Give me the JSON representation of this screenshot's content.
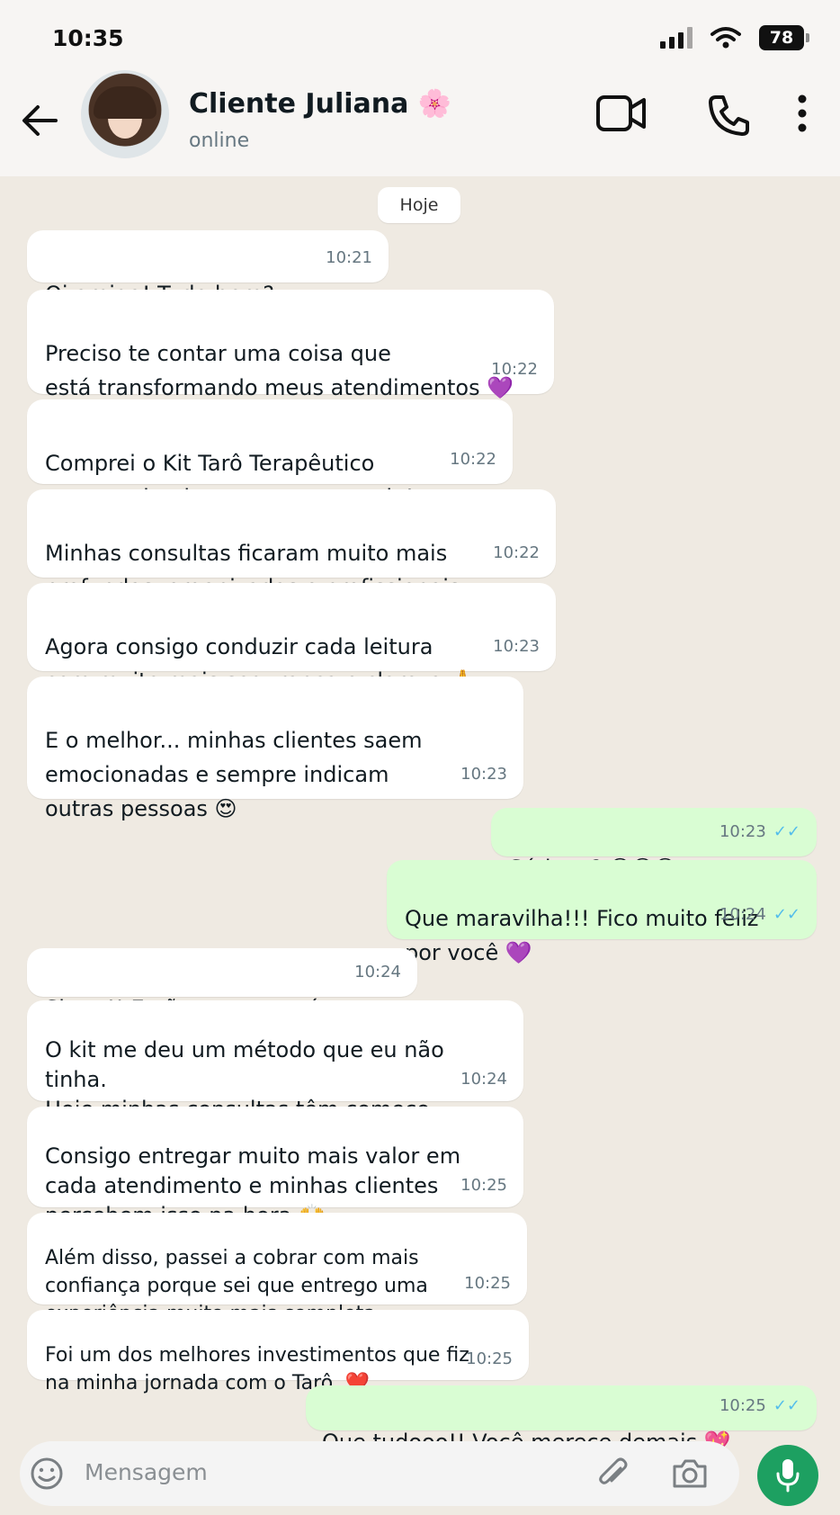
{
  "status_bar": {
    "time": "10:35",
    "battery": "78"
  },
  "header": {
    "name": "Cliente Juliana 🌸",
    "status": "online"
  },
  "date_chip": "Hoje",
  "messages": [
    {
      "text": "Oi amiga! Tudo bem?",
      "time": "10:21",
      "dir": "in"
    },
    {
      "text": "Preciso te contar uma coisa que\nestá transformando meus atendimentos 💜",
      "time": "10:22",
      "dir": "in"
    },
    {
      "text": "Comprei o Kit Tarô Terapêutico\ne estou simplesmente encantada!",
      "time": "10:22",
      "dir": "in"
    },
    {
      "text": "Minhas consultas ficaram muito mais\nprofundas, organizadas e profissionais.",
      "time": "10:22",
      "dir": "in"
    },
    {
      "text": "Agora consigo conduzir cada leitura\ncom muito mais segurança e clareza 🙏",
      "time": "10:23",
      "dir": "in"
    },
    {
      "text": "E o melhor... minhas clientes saem\nemocionadas e sempre indicam\noutras pessoas 😍",
      "time": "10:23",
      "dir": "in"
    },
    {
      "text": "Sériooo? 😍😍😍",
      "time": "10:23",
      "dir": "out",
      "ticks": "✓✓"
    },
    {
      "text": "Que maravilha!!! Fico muito feliz\npor você 💜",
      "time": "10:24",
      "dir": "out",
      "ticks": "✓✓"
    },
    {
      "text": "Simm!! E não para por aí...",
      "time": "10:24",
      "dir": "in"
    },
    {
      "text": "O kit me deu um método que eu não tinha.\nHoje minhas consultas têm começo,\nmeio e fim.",
      "time": "10:24",
      "dir": "in"
    },
    {
      "text": "Consigo entregar muito mais valor em\ncada atendimento e minhas clientes\npercebem isso na hora 🙌",
      "time": "10:25",
      "dir": "in"
    },
    {
      "text": "Além disso, passei a cobrar com mais\nconfiança porque sei que entrego uma\nexperiência muito mais completa.",
      "time": "10:25",
      "dir": "in"
    },
    {
      "text": "Foi um dos melhores investimentos que fiz\nna minha jornada com o Tarô. ❤️",
      "time": "10:25",
      "dir": "in"
    },
    {
      "text": "Que tudooo!! Você merece demais 💖",
      "time": "10:25",
      "dir": "out",
      "ticks": "✓✓"
    }
  ],
  "composer": {
    "placeholder": "Mensagem"
  },
  "colors": {
    "incoming": "#ffffff",
    "outgoing": "#d9fdd3",
    "ticks": "#53bdeb",
    "mic": "#1da061",
    "chat_bg": "#efeae2"
  },
  "icons": [
    "back-arrow-icon",
    "video-call-icon",
    "phone-icon",
    "more-options-icon",
    "emoji-icon",
    "attach-icon",
    "camera-icon",
    "mic-icon"
  ]
}
